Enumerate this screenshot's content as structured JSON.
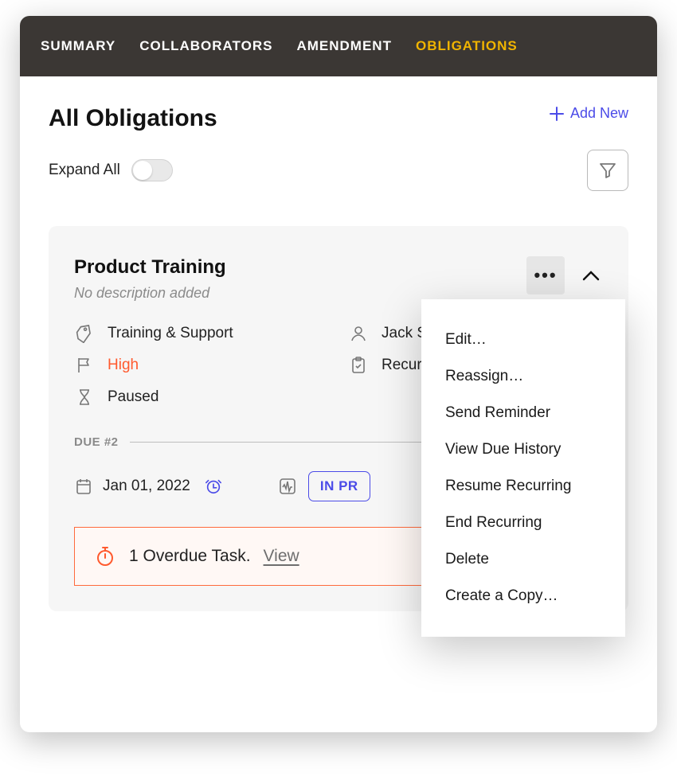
{
  "tabs": {
    "summary": "SUMMARY",
    "collaborators": "COLLABORATORS",
    "amendment": "AMENDMENT",
    "obligations": "OBLIGATIONS"
  },
  "header": {
    "title": "All Obligations",
    "add_new": "Add New",
    "expand_all": "Expand All"
  },
  "obligation": {
    "title": "Product Training",
    "description": "No description added",
    "category": "Training & Support",
    "owner": "Jack Sm",
    "priority": "High",
    "type": "Recurr",
    "state": "Paused",
    "due_label": "DUE #2",
    "due_date": "Jan 01, 2022",
    "status": "IN PR",
    "overdue_text": "1 Overdue Task.",
    "overdue_link": "View"
  },
  "menu": {
    "edit": "Edit…",
    "reassign": "Reassign…",
    "send_reminder": "Send Reminder",
    "view_due_history": "View Due History",
    "resume_recurring": "Resume Recurring",
    "end_recurring": "End Recurring",
    "delete": "Delete",
    "create_copy": "Create a Copy…"
  },
  "colors": {
    "accent_tab": "#f0b400",
    "link": "#4b4be8",
    "priority": "#ff5a2e",
    "overdue_border": "#ff6a3c"
  }
}
